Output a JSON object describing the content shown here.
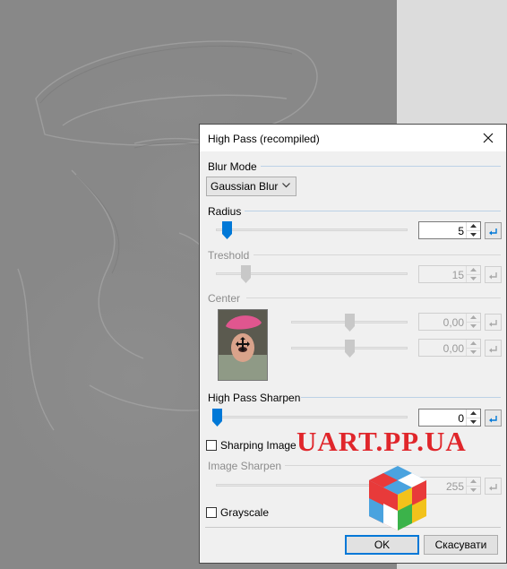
{
  "dialog": {
    "title": "High Pass (recompiled)",
    "blur_mode": {
      "label": "Blur Mode",
      "selected": "Gaussian Blur"
    },
    "radius": {
      "label": "Radius",
      "value": "5",
      "slider_fraction": 0.03
    },
    "treshold": {
      "label": "Treshold",
      "value": "15",
      "slider_fraction": 0.06
    },
    "center": {
      "label": "Center",
      "x_value": "0,00",
      "y_value": "0,00"
    },
    "high_pass_sharpen": {
      "label": "High Pass Sharpen",
      "value": "0",
      "slider_fraction": 0.0
    },
    "sharping_image": {
      "label": "Sharping Image",
      "checked": false
    },
    "image_sharpen": {
      "label": "Image Sharpen",
      "value": "255"
    },
    "grayscale": {
      "label": "Grayscale",
      "checked": false
    },
    "buttons": {
      "ok": "OK",
      "cancel": "Скасувати"
    }
  },
  "watermark": {
    "text": "UART.PP.UA"
  },
  "colors": {
    "accent": "#0078d7",
    "watermark": "#e0262b",
    "section_line": "#bcd1e6"
  },
  "icons": [
    "close-icon",
    "chevron-down-icon",
    "spin-up-icon",
    "spin-down-icon",
    "reset-icon",
    "move-icon",
    "cube-logo"
  ]
}
